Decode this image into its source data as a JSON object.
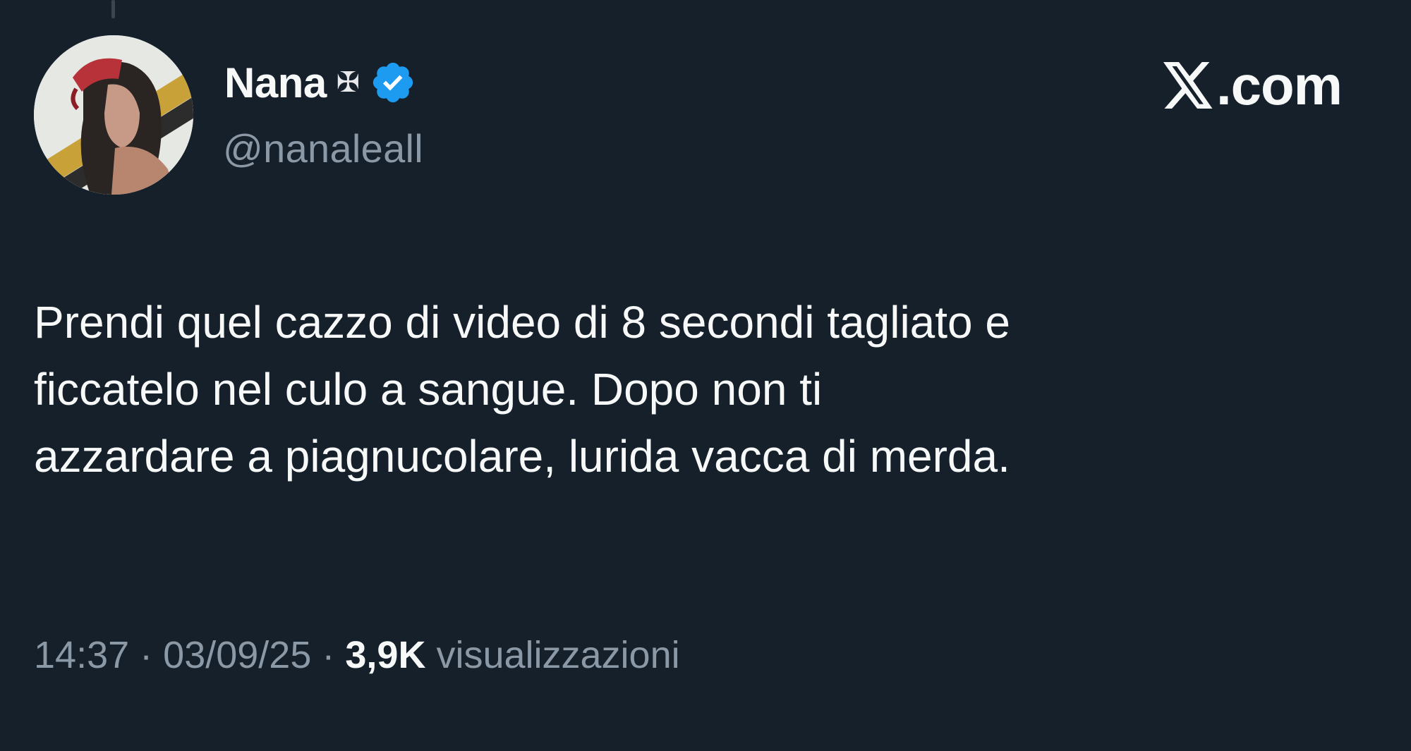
{
  "author": {
    "display_name": "Nana",
    "name_symbol": "✠",
    "handle": "@nanaleall",
    "verified": true,
    "verified_color": "#1d9bf0",
    "avatar_icon": "profile-photo"
  },
  "brand": {
    "logo_icon": "x-logo-icon",
    "text": ".com"
  },
  "tweet": {
    "text": "Prendi quel cazzo di video di 8 secondi tagliato e\nficcatelo nel culo a sangue. Dopo non ti\nazzardare a piagnucolare, lurida vacca di merda."
  },
  "meta": {
    "time": "14:37",
    "separator": "·",
    "date": "03/09/25",
    "views_count": "3,9K",
    "views_label": "visualizzazioni"
  },
  "colors": {
    "background": "#15202b",
    "text_primary": "#f7f9f9",
    "text_secondary": "#8b98a5",
    "accent": "#1d9bf0"
  }
}
